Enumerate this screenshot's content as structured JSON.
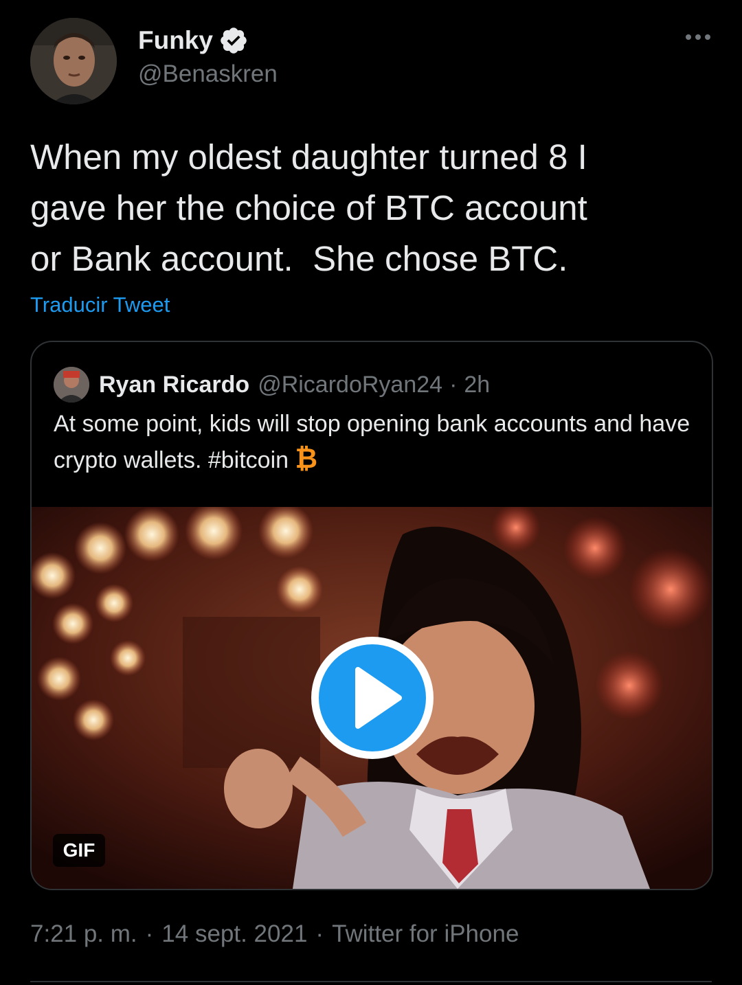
{
  "tweet": {
    "author": {
      "display_name": "Funky",
      "handle": "@Benaskren",
      "verified_icon": "verified-badge-icon"
    },
    "text": "When my oldest daughter turned 8 I\ngave her the choice of BTC account\nor Bank account.  She chose BTC.",
    "translate_label": "Traducir Tweet",
    "more_icon": "more-options-icon"
  },
  "quote": {
    "display_name": "Ryan Ricardo",
    "handle": "@RicardoRyan24",
    "separator": "·",
    "time": "2h",
    "text": "At some point, kids will stop opening bank accounts and have crypto wallets. #bitcoin",
    "emoji": "₿",
    "media": {
      "badge": "GIF",
      "play_icon": "play-icon"
    }
  },
  "meta": {
    "time": "7:21 p. m.",
    "separator": "·",
    "date": "14 sept. 2021",
    "source": "Twitter for iPhone"
  },
  "colors": {
    "background": "#000000",
    "text": "#e7e9ea",
    "secondary": "#71767b",
    "link": "#1d9bf0",
    "border": "#2f3336",
    "bitcoin": "#f7931a"
  }
}
